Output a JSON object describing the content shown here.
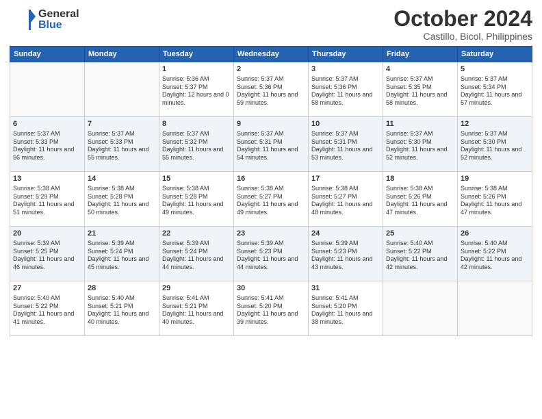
{
  "header": {
    "logo_general": "General",
    "logo_blue": "Blue",
    "month": "October 2024",
    "location": "Castillo, Bicol, Philippines"
  },
  "days_of_week": [
    "Sunday",
    "Monday",
    "Tuesday",
    "Wednesday",
    "Thursday",
    "Friday",
    "Saturday"
  ],
  "weeks": [
    [
      {
        "day": "",
        "sunrise": "",
        "sunset": "",
        "daylight": ""
      },
      {
        "day": "",
        "sunrise": "",
        "sunset": "",
        "daylight": ""
      },
      {
        "day": "1",
        "sunrise": "Sunrise: 5:36 AM",
        "sunset": "Sunset: 5:37 PM",
        "daylight": "Daylight: 12 hours and 0 minutes."
      },
      {
        "day": "2",
        "sunrise": "Sunrise: 5:37 AM",
        "sunset": "Sunset: 5:36 PM",
        "daylight": "Daylight: 11 hours and 59 minutes."
      },
      {
        "day": "3",
        "sunrise": "Sunrise: 5:37 AM",
        "sunset": "Sunset: 5:36 PM",
        "daylight": "Daylight: 11 hours and 58 minutes."
      },
      {
        "day": "4",
        "sunrise": "Sunrise: 5:37 AM",
        "sunset": "Sunset: 5:35 PM",
        "daylight": "Daylight: 11 hours and 58 minutes."
      },
      {
        "day": "5",
        "sunrise": "Sunrise: 5:37 AM",
        "sunset": "Sunset: 5:34 PM",
        "daylight": "Daylight: 11 hours and 57 minutes."
      }
    ],
    [
      {
        "day": "6",
        "sunrise": "Sunrise: 5:37 AM",
        "sunset": "Sunset: 5:33 PM",
        "daylight": "Daylight: 11 hours and 56 minutes."
      },
      {
        "day": "7",
        "sunrise": "Sunrise: 5:37 AM",
        "sunset": "Sunset: 5:33 PM",
        "daylight": "Daylight: 11 hours and 55 minutes."
      },
      {
        "day": "8",
        "sunrise": "Sunrise: 5:37 AM",
        "sunset": "Sunset: 5:32 PM",
        "daylight": "Daylight: 11 hours and 55 minutes."
      },
      {
        "day": "9",
        "sunrise": "Sunrise: 5:37 AM",
        "sunset": "Sunset: 5:31 PM",
        "daylight": "Daylight: 11 hours and 54 minutes."
      },
      {
        "day": "10",
        "sunrise": "Sunrise: 5:37 AM",
        "sunset": "Sunset: 5:31 PM",
        "daylight": "Daylight: 11 hours and 53 minutes."
      },
      {
        "day": "11",
        "sunrise": "Sunrise: 5:37 AM",
        "sunset": "Sunset: 5:30 PM",
        "daylight": "Daylight: 11 hours and 52 minutes."
      },
      {
        "day": "12",
        "sunrise": "Sunrise: 5:37 AM",
        "sunset": "Sunset: 5:30 PM",
        "daylight": "Daylight: 11 hours and 52 minutes."
      }
    ],
    [
      {
        "day": "13",
        "sunrise": "Sunrise: 5:38 AM",
        "sunset": "Sunset: 5:29 PM",
        "daylight": "Daylight: 11 hours and 51 minutes."
      },
      {
        "day": "14",
        "sunrise": "Sunrise: 5:38 AM",
        "sunset": "Sunset: 5:28 PM",
        "daylight": "Daylight: 11 hours and 50 minutes."
      },
      {
        "day": "15",
        "sunrise": "Sunrise: 5:38 AM",
        "sunset": "Sunset: 5:28 PM",
        "daylight": "Daylight: 11 hours and 49 minutes."
      },
      {
        "day": "16",
        "sunrise": "Sunrise: 5:38 AM",
        "sunset": "Sunset: 5:27 PM",
        "daylight": "Daylight: 11 hours and 49 minutes."
      },
      {
        "day": "17",
        "sunrise": "Sunrise: 5:38 AM",
        "sunset": "Sunset: 5:27 PM",
        "daylight": "Daylight: 11 hours and 48 minutes."
      },
      {
        "day": "18",
        "sunrise": "Sunrise: 5:38 AM",
        "sunset": "Sunset: 5:26 PM",
        "daylight": "Daylight: 11 hours and 47 minutes."
      },
      {
        "day": "19",
        "sunrise": "Sunrise: 5:38 AM",
        "sunset": "Sunset: 5:26 PM",
        "daylight": "Daylight: 11 hours and 47 minutes."
      }
    ],
    [
      {
        "day": "20",
        "sunrise": "Sunrise: 5:39 AM",
        "sunset": "Sunset: 5:25 PM",
        "daylight": "Daylight: 11 hours and 46 minutes."
      },
      {
        "day": "21",
        "sunrise": "Sunrise: 5:39 AM",
        "sunset": "Sunset: 5:24 PM",
        "daylight": "Daylight: 11 hours and 45 minutes."
      },
      {
        "day": "22",
        "sunrise": "Sunrise: 5:39 AM",
        "sunset": "Sunset: 5:24 PM",
        "daylight": "Daylight: 11 hours and 44 minutes."
      },
      {
        "day": "23",
        "sunrise": "Sunrise: 5:39 AM",
        "sunset": "Sunset: 5:23 PM",
        "daylight": "Daylight: 11 hours and 44 minutes."
      },
      {
        "day": "24",
        "sunrise": "Sunrise: 5:39 AM",
        "sunset": "Sunset: 5:23 PM",
        "daylight": "Daylight: 11 hours and 43 minutes."
      },
      {
        "day": "25",
        "sunrise": "Sunrise: 5:40 AM",
        "sunset": "Sunset: 5:22 PM",
        "daylight": "Daylight: 11 hours and 42 minutes."
      },
      {
        "day": "26",
        "sunrise": "Sunrise: 5:40 AM",
        "sunset": "Sunset: 5:22 PM",
        "daylight": "Daylight: 11 hours and 42 minutes."
      }
    ],
    [
      {
        "day": "27",
        "sunrise": "Sunrise: 5:40 AM",
        "sunset": "Sunset: 5:22 PM",
        "daylight": "Daylight: 11 hours and 41 minutes."
      },
      {
        "day": "28",
        "sunrise": "Sunrise: 5:40 AM",
        "sunset": "Sunset: 5:21 PM",
        "daylight": "Daylight: 11 hours and 40 minutes."
      },
      {
        "day": "29",
        "sunrise": "Sunrise: 5:41 AM",
        "sunset": "Sunset: 5:21 PM",
        "daylight": "Daylight: 11 hours and 40 minutes."
      },
      {
        "day": "30",
        "sunrise": "Sunrise: 5:41 AM",
        "sunset": "Sunset: 5:20 PM",
        "daylight": "Daylight: 11 hours and 39 minutes."
      },
      {
        "day": "31",
        "sunrise": "Sunrise: 5:41 AM",
        "sunset": "Sunset: 5:20 PM",
        "daylight": "Daylight: 11 hours and 38 minutes."
      },
      {
        "day": "",
        "sunrise": "",
        "sunset": "",
        "daylight": ""
      },
      {
        "day": "",
        "sunrise": "",
        "sunset": "",
        "daylight": ""
      }
    ]
  ]
}
